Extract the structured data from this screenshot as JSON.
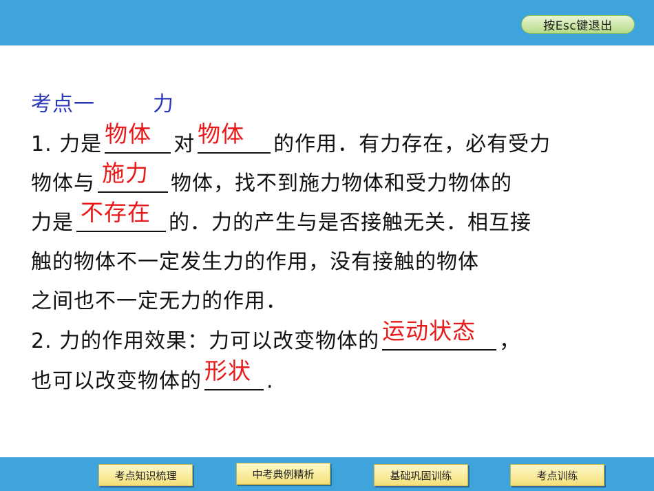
{
  "header": {
    "esc_label": "按Esc键退出"
  },
  "content": {
    "heading": {
      "prefix": "考点一",
      "topic": "力"
    },
    "p1": {
      "num": "1.",
      "t1": "力是",
      "a1": "物体",
      "t2": "对",
      "a2": "物体",
      "t3": "的作用．有力存在，必有受力",
      "t4": "物体与",
      "a3": "施力",
      "t5": "物体，找不到施力物体和受力物体的",
      "t6": "力是",
      "a4": "不存在",
      "t7": "的．力的产生与是否接触无关．相互接",
      "t8": "触的物体不一定发生力的作用，没有接触的物体",
      "t9": "之间也不一定无力的作用．"
    },
    "p2": {
      "num": "2.",
      "t1": "力的作用效果：力可以改变物体的",
      "a1": "运动状态",
      "t2": "，",
      "t3": "也可以改变物体的",
      "a2": "形状",
      "t4": "."
    }
  },
  "footer": {
    "nav": [
      "考点知识梳理",
      "中考典例精析",
      "基础巩固训练",
      "考点训练"
    ]
  }
}
